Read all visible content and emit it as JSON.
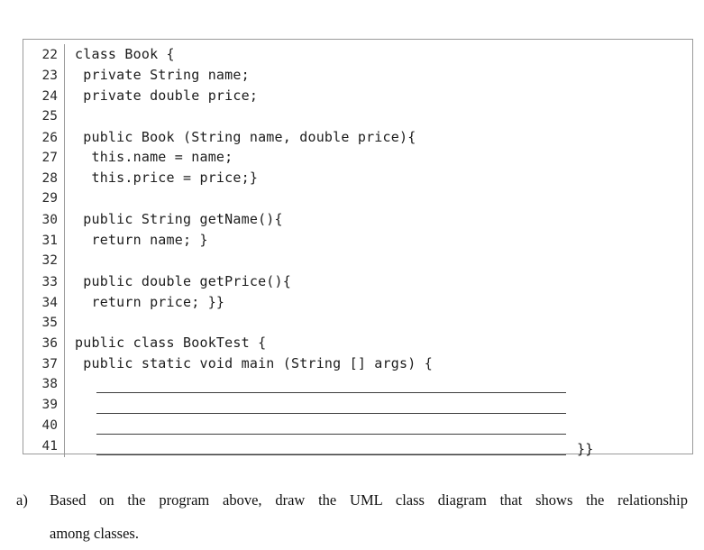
{
  "document": {
    "background_color": "#ffffff",
    "text_color": "#111111"
  },
  "code_listing": {
    "border_color": "#9a9a9a",
    "gutter_divider_color": "#9a9a9a",
    "code_text_color": "#1c1c1c",
    "line_number_color": "#2b2b2b",
    "rule_color": "#3d3d3d",
    "language": "Java",
    "first_line_number": 22,
    "last_line_number": 41,
    "lines": [
      {
        "number": "22",
        "text": "class Book {",
        "type": "code"
      },
      {
        "number": "23",
        "text": " private String name;",
        "type": "code"
      },
      {
        "number": "24",
        "text": " private double price;",
        "type": "code"
      },
      {
        "number": "25",
        "text": "",
        "type": "code"
      },
      {
        "number": "26",
        "text": " public Book (String name, double price){",
        "type": "code"
      },
      {
        "number": "27",
        "text": "  this.name = name;",
        "type": "code"
      },
      {
        "number": "28",
        "text": "  this.price = price;}",
        "type": "code"
      },
      {
        "number": "29",
        "text": "",
        "type": "code"
      },
      {
        "number": "30",
        "text": " public String getName(){",
        "type": "code"
      },
      {
        "number": "31",
        "text": "  return name; }",
        "type": "code"
      },
      {
        "number": "32",
        "text": "",
        "type": "code"
      },
      {
        "number": "33",
        "text": " public double getPrice(){",
        "type": "code"
      },
      {
        "number": "34",
        "text": "  return price; }}",
        "type": "code"
      },
      {
        "number": "35",
        "text": "",
        "type": "code"
      },
      {
        "number": "36",
        "text": "public class BookTest {",
        "type": "code"
      },
      {
        "number": "37",
        "text": " public static void main (String [] args) {",
        "type": "code"
      },
      {
        "number": "38",
        "text": "",
        "type": "blank-rule",
        "tail": ""
      },
      {
        "number": "39",
        "text": "",
        "type": "blank-rule",
        "tail": ""
      },
      {
        "number": "40",
        "text": "",
        "type": "blank-rule",
        "tail": ""
      },
      {
        "number": "41",
        "text": "",
        "type": "blank-rule",
        "tail": "}}"
      }
    ]
  },
  "question": {
    "marker": "a)",
    "line_1": "Based on the program above, draw the UML class diagram that shows the relationship",
    "line_2": "among classes.",
    "full_text": "Based on the program above, draw the UML class diagram that shows the relationship among classes."
  }
}
